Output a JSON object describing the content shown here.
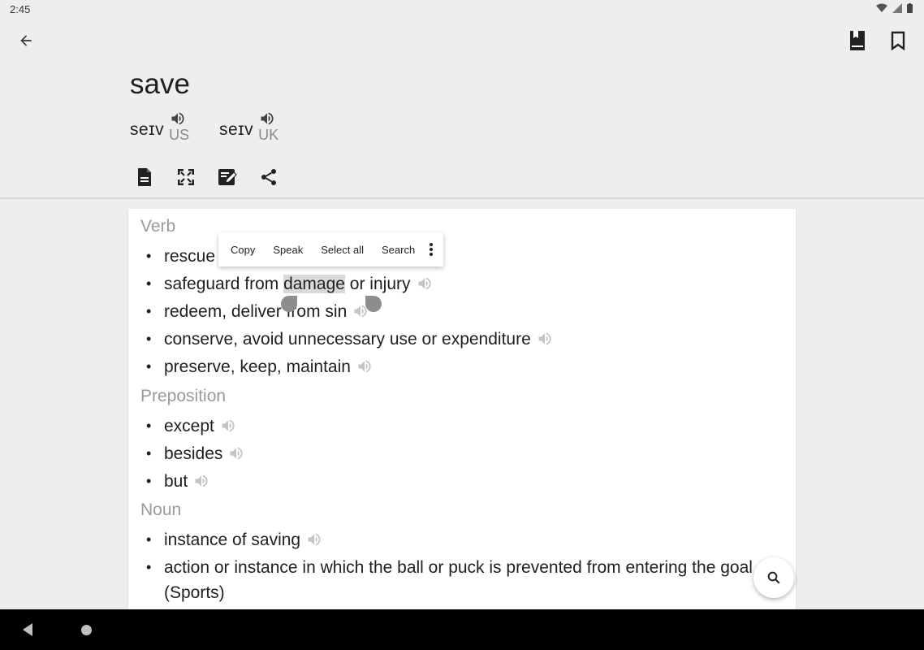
{
  "status_bar": {
    "time": "2:45"
  },
  "header": {
    "back_icon": "arrow-left-icon",
    "actions": [
      "book-icon",
      "bookmark-icon"
    ]
  },
  "word": {
    "title": "save",
    "pronunciations": [
      {
        "ipa": "seɪv",
        "region": "US"
      },
      {
        "ipa": "seɪv",
        "region": "UK"
      }
    ]
  },
  "toolbar": [
    "document-icon",
    "fullscreen-icon",
    "edit-note-icon",
    "share-icon"
  ],
  "sections": {
    "verb": {
      "label": "Verb",
      "items": [
        "rescue",
        {
          "before": "safeguard from ",
          "selected": "damage",
          "after": " or injury"
        },
        "redeem, deliver from sin",
        "conserve, avoid unnecessary use or expenditure",
        "preserve, keep, maintain"
      ]
    },
    "preposition": {
      "label": "Preposition",
      "items": [
        "except",
        "besides",
        "but"
      ]
    },
    "noun": {
      "label": "Noun",
      "items": [
        "instance of saving",
        "action or instance in which the ball or puck is prevented from entering the goal (Sports)"
      ]
    }
  },
  "context_menu": {
    "copy": "Copy",
    "speak": "Speak",
    "select_all": "Select all",
    "search": "Search"
  },
  "bullet": "•",
  "fab_icon": "search-icon"
}
